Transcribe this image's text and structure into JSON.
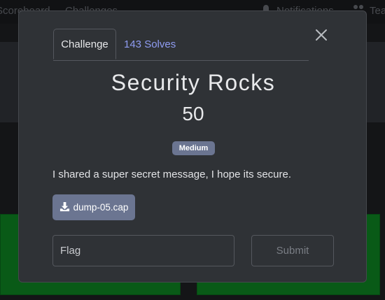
{
  "nav": {
    "scoreboard_label": "Scoreboard",
    "challenges_label": "Challenges",
    "notifications_label": "Notifications",
    "team_label": "Team"
  },
  "modal": {
    "tabs": [
      {
        "label": "Challenge",
        "active": true
      },
      {
        "label": "143 Solves",
        "active": false
      }
    ],
    "title": "Security Rocks",
    "value": "50",
    "difficulty": "Medium",
    "description": "I shared a super secret message, I hope its secure.",
    "file_label": "dump-05.cap",
    "flag_placeholder": "Flag",
    "submit_label": "Submit"
  },
  "colors": {
    "modal_bg": "#2f3236",
    "accent_link": "#8f9cf2",
    "badge_bg": "#6b7591",
    "tile_green": "#0e8a24"
  }
}
